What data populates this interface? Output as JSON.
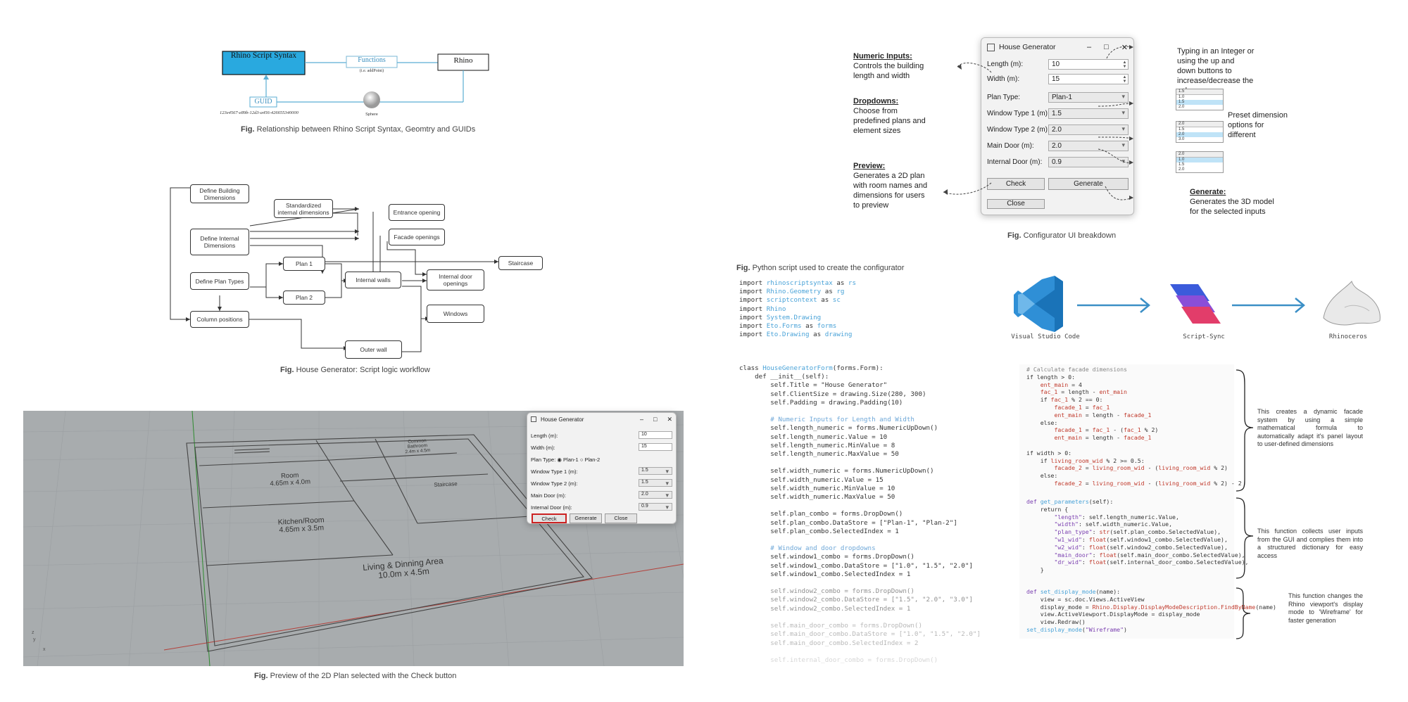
{
  "rhino_diagram": {
    "syntax": "Rhino Script Syntax",
    "functions": "Functions",
    "functions_eg": "(i.e. addPoint)",
    "rhino": "Rhino",
    "guid": "GUID",
    "sphere": "Sphere",
    "guid_value": "123e4567-e89b-12d3-a456-426655340000"
  },
  "captions": {
    "fig": "Fig.",
    "relationship": "Relationship between Rhino Script Syntax, Geomtry and GUIDs",
    "workflow": "House Generator: Script logic workflow",
    "preview": "Preview of the 2D Plan selected with the Check button",
    "configurator": "Configurator UI breakdown",
    "python": "Python script used to create the configurator"
  },
  "workflow": {
    "define_building": "Define Building Dimensions",
    "define_internal": "Define Internal Dimensions",
    "define_plan_types": "Define Plan Types",
    "column_positions": "Column positions",
    "standardized": "Standardized internal dimensions",
    "entrance": "Entrance opening",
    "facade": "Facade openings",
    "plan1": "Plan 1",
    "plan2": "Plan 2",
    "internal_walls": "Internal walls",
    "internal_door": "Internal door openings",
    "staircase": "Staircase",
    "windows": "Windows",
    "outer_wall": "Outer wall"
  },
  "small_dialog": {
    "title": "House Generator",
    "length_label": "Length (m):",
    "length_value": "10",
    "width_label": "Width (m):",
    "width_value": "15",
    "plan_type_label": "Plan Type:",
    "plan1": "Plan-1",
    "plan2": "Plan-2",
    "win1_label": "Window Type 1 (m):",
    "win1_value": "1.5",
    "win2_label": "Window Type 2 (m):",
    "win2_value": "1.5",
    "main_door_label": "Main Door (m):",
    "main_door_value": "2.0",
    "internal_door_label": "Internal Door (m):",
    "internal_door_value": "0.9",
    "check": "Check",
    "generate": "Generate",
    "close": "Close"
  },
  "plan_preview": {
    "room": "Room",
    "room_dims": "4.65m x 4.0m",
    "kitchen": "Kitchen/Room",
    "kitchen_dims": "4.65m x 3.5m",
    "living": "Living & Dinning Area",
    "living_dims": "10.0m x 4.5m",
    "staircase": "Staircase",
    "top_right_1": "Common",
    "top_right_2": "Bathroom",
    "top_right_3": "2.4m x 4.5m",
    "axis_x": "x",
    "axis_y": "y",
    "axis_z": "z"
  },
  "big_dialog": {
    "title": "House Generator",
    "length_label": "Length (m):",
    "length_value": "10",
    "width_label": "Width (m):",
    "width_value": "15",
    "plan_type_label": "Plan Type:",
    "plan_type_value": "Plan-1",
    "win1_label": "Window Type 1 (m):",
    "win1_value": "1.5",
    "win2_label": "Window Type 2 (m):",
    "win2_value": "2.0",
    "main_door_label": "Main Door (m):",
    "main_door_value": "2.0",
    "internal_door_label": "Internal Door (m):",
    "internal_door_value": "0.9",
    "check": "Check",
    "generate": "Generate",
    "close": "Close"
  },
  "annotations": {
    "numeric_h": "Numeric Inputs:",
    "numeric_t": "Controls the building length and width",
    "dropdowns_h": "Dropdowns:",
    "dropdowns_t": "Choose from predefined plans and element sizes",
    "preview_h": "Preview:",
    "preview_t": "Generates a 2D plan with room names and dimensions for users to preview",
    "typing_t": "Typing in an Integer or using the up and down buttons to increase/decrease the value",
    "preset_t": "Preset dimension options for different",
    "generate_h": "Generate:",
    "generate_t": "Generates the 3D model for the selected inputs"
  },
  "mini_lists": [
    {
      "header": "1.5",
      "items": [
        "1.0",
        "1.5",
        "2.0"
      ],
      "selected": 1
    },
    {
      "header": "2.0",
      "items": [
        "1.5",
        "2.0",
        "3.0"
      ],
      "selected": 1
    },
    {
      "header": "2.0",
      "items": [
        "1.0",
        "1.5",
        "2.0"
      ],
      "selected": 0
    }
  ],
  "pipeline": {
    "vscode": "Visual Studio Code",
    "scriptsync": "Script-Sync",
    "rhino": "Rhinoceros",
    "colors": {
      "vscode": "#2f8fd6",
      "arrow": "#3b8fc6",
      "sync_a": "#3b5bdb",
      "sync_b": "#e23d6a"
    }
  },
  "notes": {
    "facade": "This creates a dynamic facade system by using a simple mathematical formula to automatically adapt it's panel layout to user-defined dimensions",
    "params": "This function collects user inputs from the GUI and complies them into a structured dictionary for easy access",
    "display": "This function changes the Rhino viewport's display mode to 'Wireframe' for faster generation"
  },
  "highlight_color": "#cc2222"
}
